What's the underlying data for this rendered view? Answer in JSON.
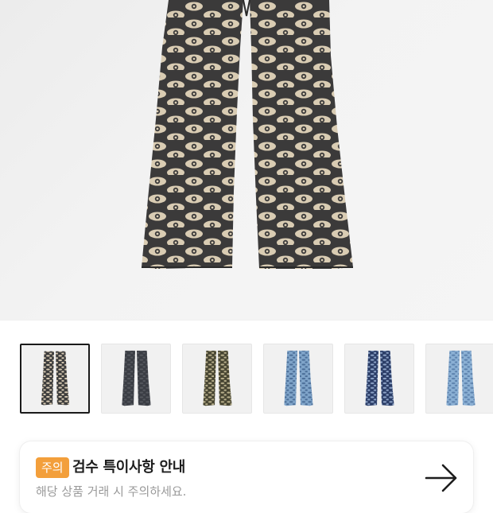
{
  "product": {
    "main_image": "eye-pattern flared denim jeans"
  },
  "thumbnails": [
    {
      "name": "eye-print black flared jeans",
      "selected": true,
      "base": "#3c3c3c",
      "pattern": "#d8cbb4"
    },
    {
      "name": "dark grey flared jeans",
      "selected": false,
      "base": "#3a3d44",
      "pattern": "#55585e"
    },
    {
      "name": "olive pattern flared jeans",
      "selected": false,
      "base": "#474532",
      "pattern": "#b9b08c"
    },
    {
      "name": "light blue patched flared jeans",
      "selected": false,
      "base": "#7fa4c9",
      "pattern": "#4b6e98"
    },
    {
      "name": "navy pattern flared jeans",
      "selected": false,
      "base": "#2b3d67",
      "pattern": "#8da3c7"
    },
    {
      "name": "light blue pattern flared jeans",
      "selected": false,
      "base": "#8bb0d4",
      "pattern": "#5d82ad"
    }
  ],
  "notice": {
    "badge": "주의",
    "title": "검수 특이사항 안내",
    "subtitle": "해당 상품 거래 시 주의하세요.",
    "badge_color": "#f39f3b",
    "arrow_icon": "arrow-right-icon"
  }
}
